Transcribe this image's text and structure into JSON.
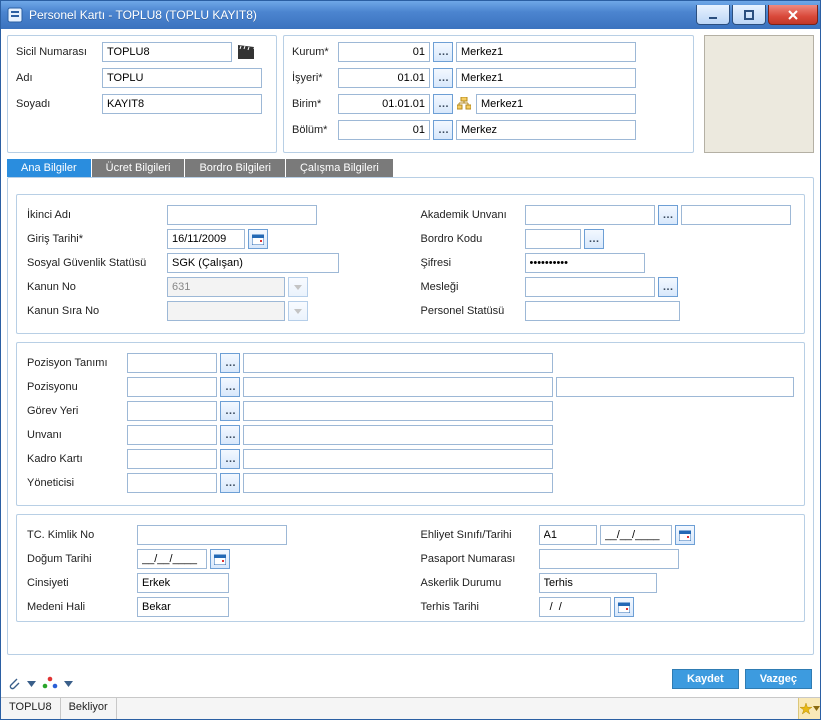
{
  "window": {
    "title": "Personel Kartı - TOPLU8 (TOPLU KAYIT8)"
  },
  "identity": {
    "sicil_label": "Sicil Numarası",
    "sicil": "TOPLU8",
    "adi_label": "Adı",
    "adi": "TOPLU",
    "soyadi_label": "Soyadı",
    "soyadi": "KAYIT8"
  },
  "org": {
    "kurum_label": "Kurum*",
    "kurum_code": "01",
    "kurum_name": "Merkez1",
    "isyeri_label": "İşyeri*",
    "isyeri_code": "01.01",
    "isyeri_name": "Merkez1",
    "birim_label": "Birim*",
    "birim_code": "01.01.01",
    "birim_name": "Merkez1",
    "bolum_label": "Bölüm*",
    "bolum_code": "01",
    "bolum_name": "Merkez"
  },
  "tabs": {
    "t1": "Ana Bilgiler",
    "t2": "Ücret Bilgileri",
    "t3": "Bordro Bilgileri",
    "t4": "Çalışma Bilgileri"
  },
  "main": {
    "left": {
      "ikinci_adi_label": "İkinci Adı",
      "ikinci_adi": "",
      "giris_tarihi_label": "Giriş Tarihi*",
      "giris_tarihi": "16/11/2009",
      "sgs_label": "Sosyal Güvenlik Statüsü",
      "sgs": "SGK (Çalışan)",
      "kanun_no_label": "Kanun No",
      "kanun_no": "631",
      "kanun_sira_label": "Kanun Sıra No",
      "kanun_sira": ""
    },
    "right": {
      "akademik_label": "Akademik Unvanı",
      "akademik": "",
      "bordro_label": "Bordro Kodu",
      "bordro": "",
      "sifre_label": "Şifresi",
      "sifre": "••••••••••",
      "meslek_label": "Mesleği",
      "meslek": "",
      "pstat_label": "Personel Statüsü",
      "pstat": ""
    },
    "positions": {
      "pozisyon_tanimi_label": "Pozisyon Tanımı",
      "pozisyonu_label": "Pozisyonu",
      "gorev_yeri_label": "Görev Yeri",
      "unvani_label": "Unvanı",
      "kadro_karti_label": "Kadro Kartı",
      "yoneticisi_label": "Yöneticisi"
    },
    "ids": {
      "tc_label": "TC. Kimlik No",
      "tc": "",
      "dogum_label": "Doğum Tarihi",
      "dogum": "__/__/____",
      "cinsiyet_label": "Cinsiyeti",
      "cinsiyet": "Erkek",
      "medeni_label": "Medeni Hali",
      "medeni": "Bekar",
      "ehliyet_label": "Ehliyet Sınıfı/Tarihi",
      "ehliyet_sinif": "A1",
      "ehliyet_tarih": "__/__/____",
      "pasaport_label": "Pasaport Numarası",
      "pasaport": "",
      "askerlik_label": "Askerlik Durumu",
      "askerlik": "Terhis",
      "terhis_label": "Terhis Tarihi",
      "terhis": "  /  /"
    }
  },
  "buttons": {
    "save": "Kaydet",
    "cancel": "Vazgeç"
  },
  "status": {
    "left": "TOPLU8",
    "right": "Bekliyor"
  }
}
